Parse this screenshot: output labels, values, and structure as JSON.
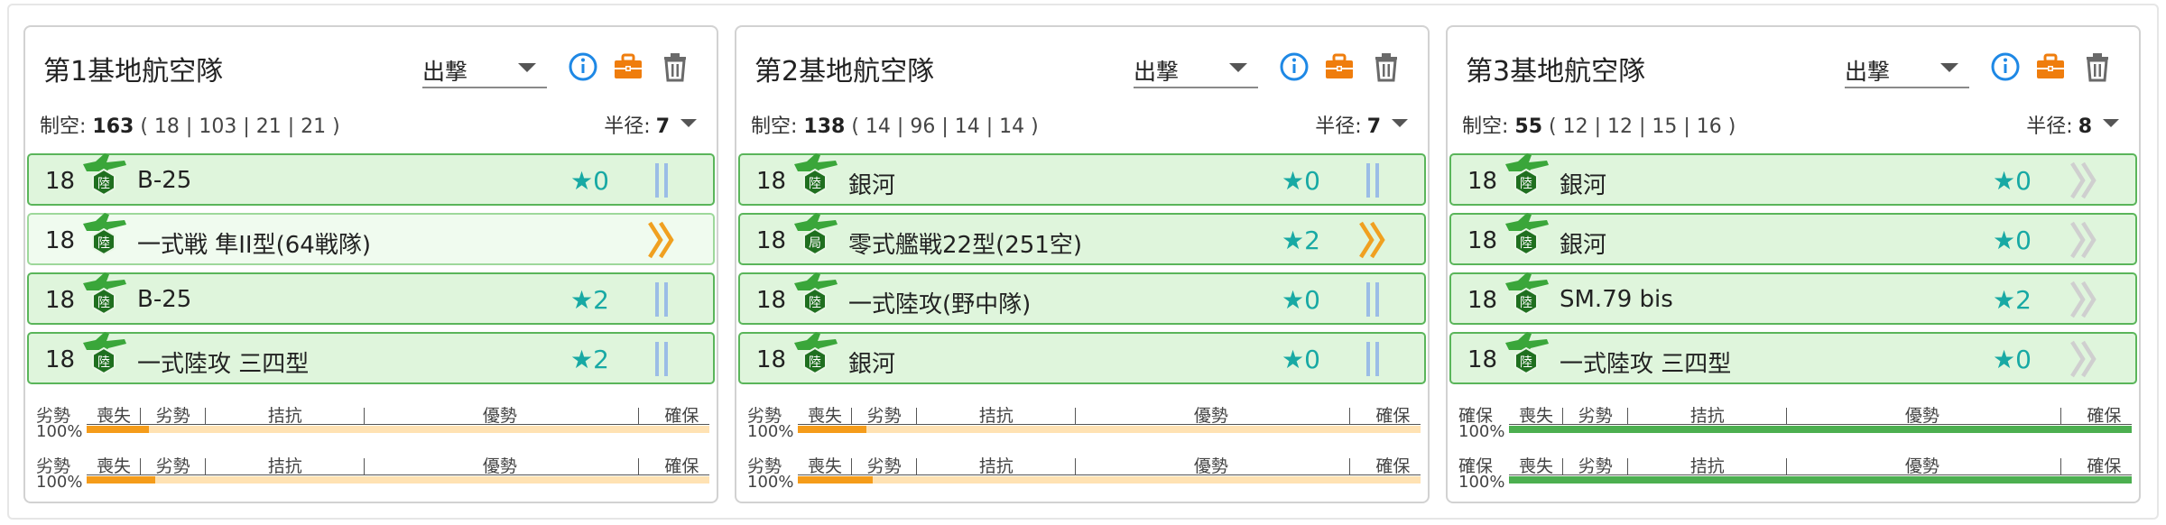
{
  "panels": [
    {
      "title": "第1基地航空隊",
      "mode": "出撃",
      "stats": {
        "label": "制空:",
        "value": "163",
        "breakdown": "( 18 | 103 | 21 | 21 )"
      },
      "radius": {
        "label": "半径:",
        "value": "7"
      },
      "slots": [
        {
          "count": "18",
          "name": "B-25",
          "icon": "land-attacker-icon",
          "badge": "陸",
          "star": "★",
          "level": "0",
          "proficiency": "blue-double-bar",
          "light": false
        },
        {
          "count": "18",
          "name": "一式戦 隼II型(64戦隊)",
          "icon": "land-fighter-icon",
          "badge": "陸",
          "star": "",
          "level": "",
          "proficiency": "orange-double-chevron",
          "light": true
        },
        {
          "count": "18",
          "name": "B-25",
          "icon": "land-attacker-icon",
          "badge": "陸",
          "star": "★",
          "level": "2",
          "proficiency": "blue-double-bar",
          "light": false
        },
        {
          "count": "18",
          "name": "一式陸攻 三四型",
          "icon": "land-attacker-icon",
          "badge": "陸",
          "star": "★",
          "level": "2",
          "proficiency": "blue-double-bar",
          "light": false
        }
      ],
      "gauges": [
        {
          "status": "劣勢",
          "percent": "100%",
          "fill": 0.1,
          "labels": [
            "喪失",
            "劣勢",
            "拮抗",
            "優勢",
            "確保"
          ],
          "color": "orange"
        },
        {
          "status": "劣勢",
          "percent": "100%",
          "fill": 0.11,
          "labels": [
            "喪失",
            "劣勢",
            "拮抗",
            "優勢",
            "確保"
          ],
          "color": "orange"
        }
      ]
    },
    {
      "title": "第2基地航空隊",
      "mode": "出撃",
      "stats": {
        "label": "制空:",
        "value": "138",
        "breakdown": "( 14 | 96 | 14 | 14 )"
      },
      "radius": {
        "label": "半径:",
        "value": "7"
      },
      "slots": [
        {
          "count": "18",
          "name": "銀河",
          "icon": "land-attacker-icon",
          "badge": "陸",
          "star": "★",
          "level": "0",
          "proficiency": "blue-double-bar",
          "light": false
        },
        {
          "count": "18",
          "name": "零式艦戦22型(251空)",
          "icon": "land-fighter-icon",
          "badge": "局",
          "star": "★",
          "level": "2",
          "proficiency": "orange-double-chevron",
          "light": false
        },
        {
          "count": "18",
          "name": "一式陸攻(野中隊)",
          "icon": "land-attacker-icon",
          "badge": "陸",
          "star": "★",
          "level": "0",
          "proficiency": "blue-double-bar",
          "light": false
        },
        {
          "count": "18",
          "name": "銀河",
          "icon": "land-attacker-icon",
          "badge": "陸",
          "star": "★",
          "level": "0",
          "proficiency": "blue-double-bar",
          "light": false
        }
      ],
      "gauges": [
        {
          "status": "劣勢",
          "percent": "100%",
          "fill": 0.11,
          "labels": [
            "喪失",
            "劣勢",
            "拮抗",
            "優勢",
            "確保"
          ],
          "color": "orange"
        },
        {
          "status": "劣勢",
          "percent": "100%",
          "fill": 0.12,
          "labels": [
            "喪失",
            "劣勢",
            "拮抗",
            "優勢",
            "確保"
          ],
          "color": "orange"
        }
      ]
    },
    {
      "title": "第3基地航空隊",
      "mode": "出撃",
      "stats": {
        "label": "制空:",
        "value": "55",
        "breakdown": "( 12 | 12 | 15 | 16 )"
      },
      "radius": {
        "label": "半径:",
        "value": "8"
      },
      "slots": [
        {
          "count": "18",
          "name": "銀河",
          "icon": "land-attacker-icon",
          "badge": "陸",
          "star": "★",
          "level": "0",
          "proficiency": "gray-double-chevron",
          "light": false
        },
        {
          "count": "18",
          "name": "銀河",
          "icon": "land-attacker-icon",
          "badge": "陸",
          "star": "★",
          "level": "0",
          "proficiency": "gray-double-chevron",
          "light": false
        },
        {
          "count": "18",
          "name": "SM.79 bis",
          "icon": "land-attacker-icon",
          "badge": "陸",
          "star": "★",
          "level": "2",
          "proficiency": "gray-double-chevron",
          "light": false
        },
        {
          "count": "18",
          "name": "一式陸攻 三四型",
          "icon": "land-attacker-icon",
          "badge": "陸",
          "star": "★",
          "level": "0",
          "proficiency": "gray-double-chevron",
          "light": false
        }
      ],
      "gauges": [
        {
          "status": "確保",
          "percent": "100%",
          "fill": 1.0,
          "labels": [
            "喪失",
            "劣勢",
            "拮抗",
            "優勢",
            "確保"
          ],
          "color": "green"
        },
        {
          "status": "確保",
          "percent": "100%",
          "fill": 1.0,
          "labels": [
            "喪失",
            "劣勢",
            "拮抗",
            "優勢",
            "確保"
          ],
          "color": "green"
        }
      ]
    }
  ],
  "colors": {
    "slot_bg": "#dff5dc",
    "slot_border": "#5ab55a",
    "star": "#18a9a4",
    "info": "#1e88e5",
    "toolbox": "#ef7d0d",
    "gauge_orange": "#f59c1a",
    "gauge_orange_track": "#ffe2b3",
    "gauge_green": "#4caf50"
  }
}
